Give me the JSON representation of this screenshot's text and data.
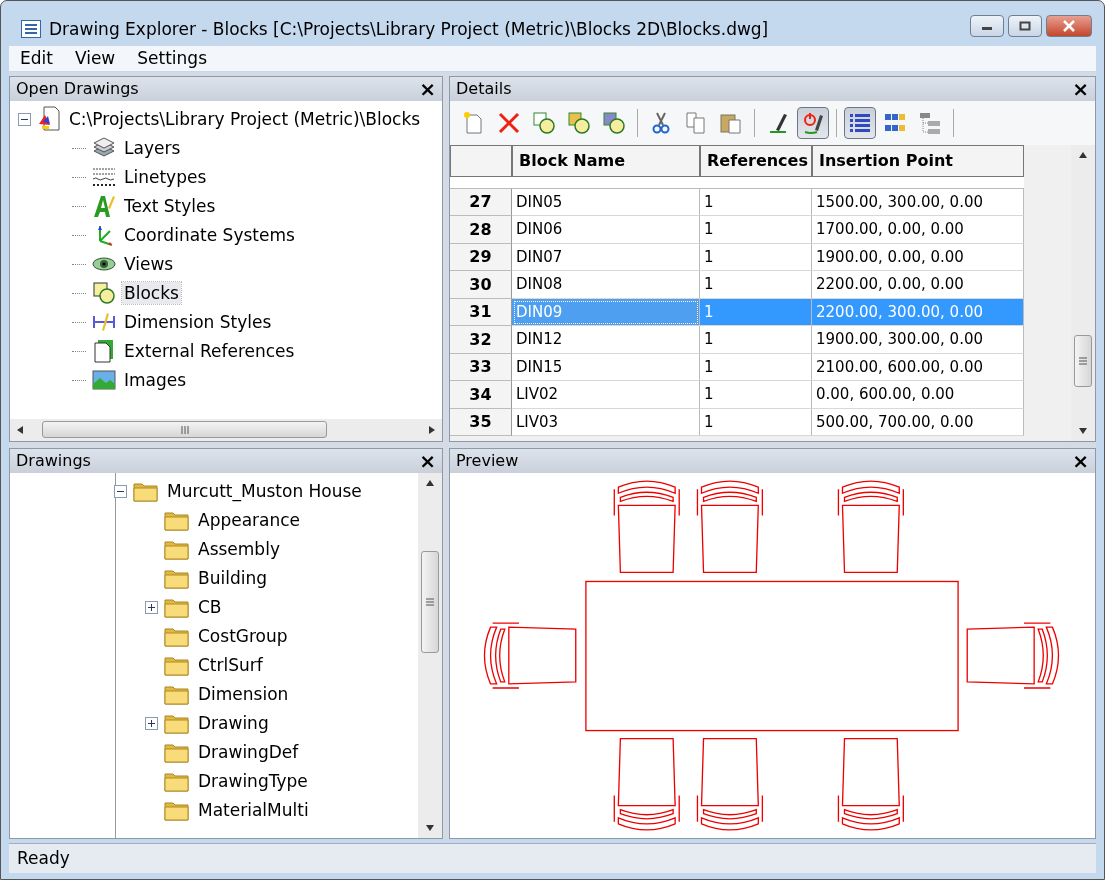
{
  "window": {
    "title": "Drawing Explorer - Blocks [C:\\Projects\\Library Project (Metric)\\Blocks 2D\\Blocks.dwg]"
  },
  "menu": [
    "Edit",
    "View",
    "Settings"
  ],
  "open_drawings": {
    "title": "Open Drawings",
    "close": "×",
    "root": {
      "label": "C:\\Projects\\Library Project (Metric)\\Blocks",
      "expanded": true,
      "children": [
        {
          "label": "Layers",
          "kind": "layers",
          "selected": false
        },
        {
          "label": "Linetypes",
          "kind": "linetypes",
          "selected": false
        },
        {
          "label": "Text Styles",
          "kind": "textstyles",
          "selected": false
        },
        {
          "label": "Coordinate Systems",
          "kind": "ucs",
          "selected": false
        },
        {
          "label": "Views",
          "kind": "views",
          "selected": false
        },
        {
          "label": "Blocks",
          "kind": "blocks",
          "selected": true
        },
        {
          "label": "Dimension Styles",
          "kind": "dimstyles",
          "selected": false
        },
        {
          "label": "External References",
          "kind": "xrefs",
          "selected": false
        },
        {
          "label": "Images",
          "kind": "images",
          "selected": false
        }
      ]
    }
  },
  "details": {
    "title": "Details",
    "close": "×",
    "toolbar": [
      {
        "kind": "new",
        "pressed": false
      },
      {
        "kind": "delete",
        "pressed": false
      },
      {
        "kind": "insert",
        "pressed": false
      },
      {
        "kind": "open",
        "pressed": false
      },
      {
        "kind": "save",
        "pressed": false
      },
      {
        "kind": "separator"
      },
      {
        "kind": "cut",
        "pressed": false
      },
      {
        "kind": "copy",
        "pressed": false
      },
      {
        "kind": "paste",
        "pressed": false
      },
      {
        "kind": "separator"
      },
      {
        "kind": "edit",
        "pressed": false
      },
      {
        "kind": "power",
        "pressed": true
      },
      {
        "kind": "separator"
      },
      {
        "kind": "details",
        "pressed": true
      },
      {
        "kind": "icons",
        "pressed": false
      },
      {
        "kind": "tree",
        "pressed": false
      },
      {
        "kind": "separator"
      }
    ],
    "columns": [
      "Block Name",
      "References",
      "Insertion Point"
    ],
    "rows": [
      {
        "num": "27",
        "cells": [
          "DIN05",
          "1",
          "1500.00, 300.00, 0.00"
        ],
        "selected": false
      },
      {
        "num": "28",
        "cells": [
          "DIN06",
          "1",
          "1700.00, 0.00, 0.00"
        ],
        "selected": false
      },
      {
        "num": "29",
        "cells": [
          "DIN07",
          "1",
          "1900.00, 0.00, 0.00"
        ],
        "selected": false
      },
      {
        "num": "30",
        "cells": [
          "DIN08",
          "1",
          "2200.00, 0.00, 0.00"
        ],
        "selected": false
      },
      {
        "num": "31",
        "cells": [
          "DIN09",
          "1",
          "2200.00, 300.00, 0.00"
        ],
        "selected": true
      },
      {
        "num": "32",
        "cells": [
          "DIN12",
          "1",
          "1900.00, 300.00, 0.00"
        ],
        "selected": false
      },
      {
        "num": "33",
        "cells": [
          "DIN15",
          "1",
          "2100.00, 600.00, 0.00"
        ],
        "selected": false
      },
      {
        "num": "34",
        "cells": [
          "LIV02",
          "1",
          "0.00, 600.00, 0.00"
        ],
        "selected": false
      },
      {
        "num": "35",
        "cells": [
          "LIV03",
          "1",
          "500.00, 700.00, 0.00"
        ],
        "selected": false
      }
    ]
  },
  "drawings": {
    "title": "Drawings",
    "close": "×",
    "root": {
      "label": "Murcutt_Muston House",
      "expanded": true,
      "children": [
        {
          "label": "Appearance",
          "expandable": false
        },
        {
          "label": "Assembly",
          "expandable": false
        },
        {
          "label": "Building",
          "expandable": false
        },
        {
          "label": "CB",
          "expandable": true
        },
        {
          "label": "CostGroup",
          "expandable": false
        },
        {
          "label": "CtrlSurf",
          "expandable": false
        },
        {
          "label": "Dimension",
          "expandable": false
        },
        {
          "label": "Drawing",
          "expandable": true
        },
        {
          "label": "DrawingDef",
          "expandable": false
        },
        {
          "label": "DrawingType",
          "expandable": false
        },
        {
          "label": "MaterialMulti",
          "expandable": false
        }
      ]
    }
  },
  "preview": {
    "title": "Preview",
    "close": "×"
  },
  "status_bar": {
    "text": "Ready"
  }
}
